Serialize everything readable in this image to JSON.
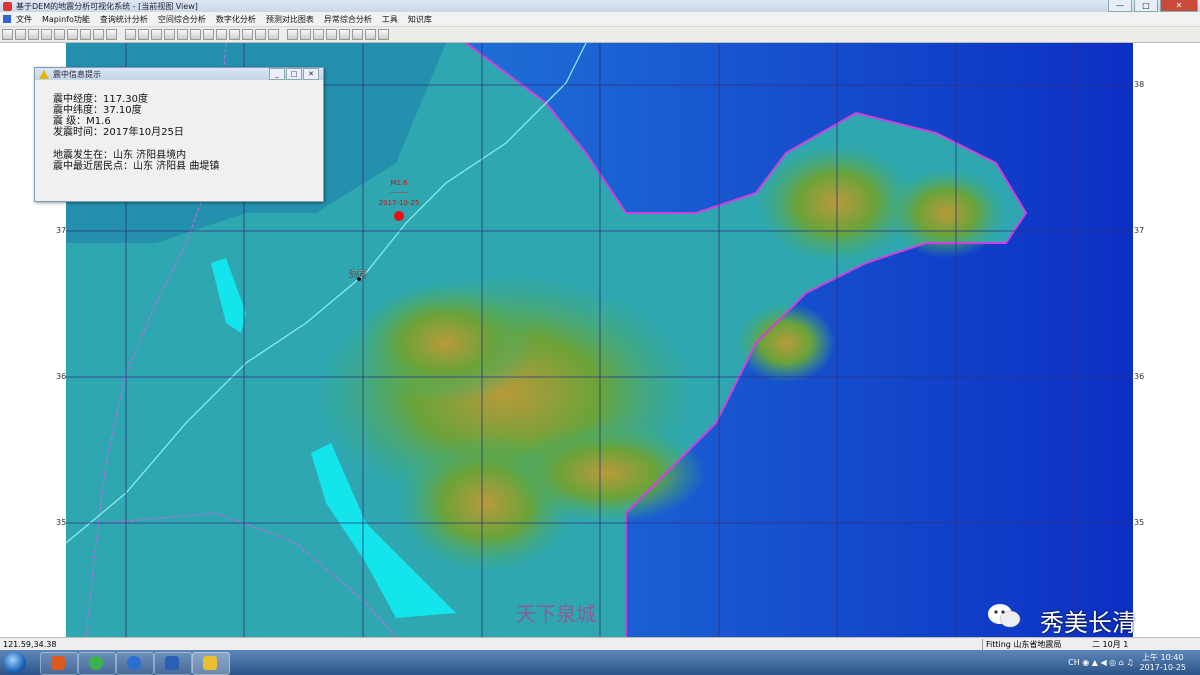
{
  "window": {
    "title": "基于DEM的地震分析可视化系统 - [当前视图 View]",
    "buttons": [
      "—",
      "□",
      "✕"
    ]
  },
  "menu": {
    "items": [
      "文件",
      "Mapinfo功能",
      "查询统计分析",
      "空间综合分析",
      "数字化分析",
      "预测对比图表",
      "异常综合分析",
      "工具",
      "知识库"
    ]
  },
  "toolbar": {
    "buttons": [
      "select",
      "zoom-in",
      "zoom-out",
      "zoom-ext",
      "pan",
      "info",
      "layers",
      "ruler",
      "label",
      "select-rect",
      "select-radius",
      "select-poly",
      "refresh",
      "legend",
      "print",
      "query",
      "chart",
      "table",
      "find",
      "style",
      "grid",
      "buffer",
      "overlay",
      "export",
      "dem",
      "profile",
      "3d",
      "settings",
      "help"
    ]
  },
  "map": {
    "lat_ticks": [
      "38",
      "37",
      "36",
      "35"
    ],
    "lon_ticks": [],
    "epicenter": {
      "magnitude": "M1.6",
      "date": "2017-10-25",
      "label_line": "--------"
    },
    "city_label": "济南"
  },
  "dialog": {
    "title": "震中信息提示",
    "lines": [
      "震中经度：117.30度",
      "震中纬度：37.10度",
      "震    级：M1.6",
      "发震时间：2017年10月25日"
    ],
    "lines2": [
      "地震发生在：山东 济阳县境内",
      "震中最近居民点：山东 济阳县 曲堤镇"
    ]
  },
  "status": {
    "left": "121.59,34.38",
    "right": "Fitting 山东省地震局",
    "right2": "二 10月 1"
  },
  "taskbar": {
    "clock_time": "上午 10:40",
    "clock_date": "2017-10-25",
    "tray": "CH ◉ ▲ ◀ ◎ ⌂ ♫"
  },
  "watermark": {
    "left": "天下泉城",
    "right": "秀美长清"
  }
}
